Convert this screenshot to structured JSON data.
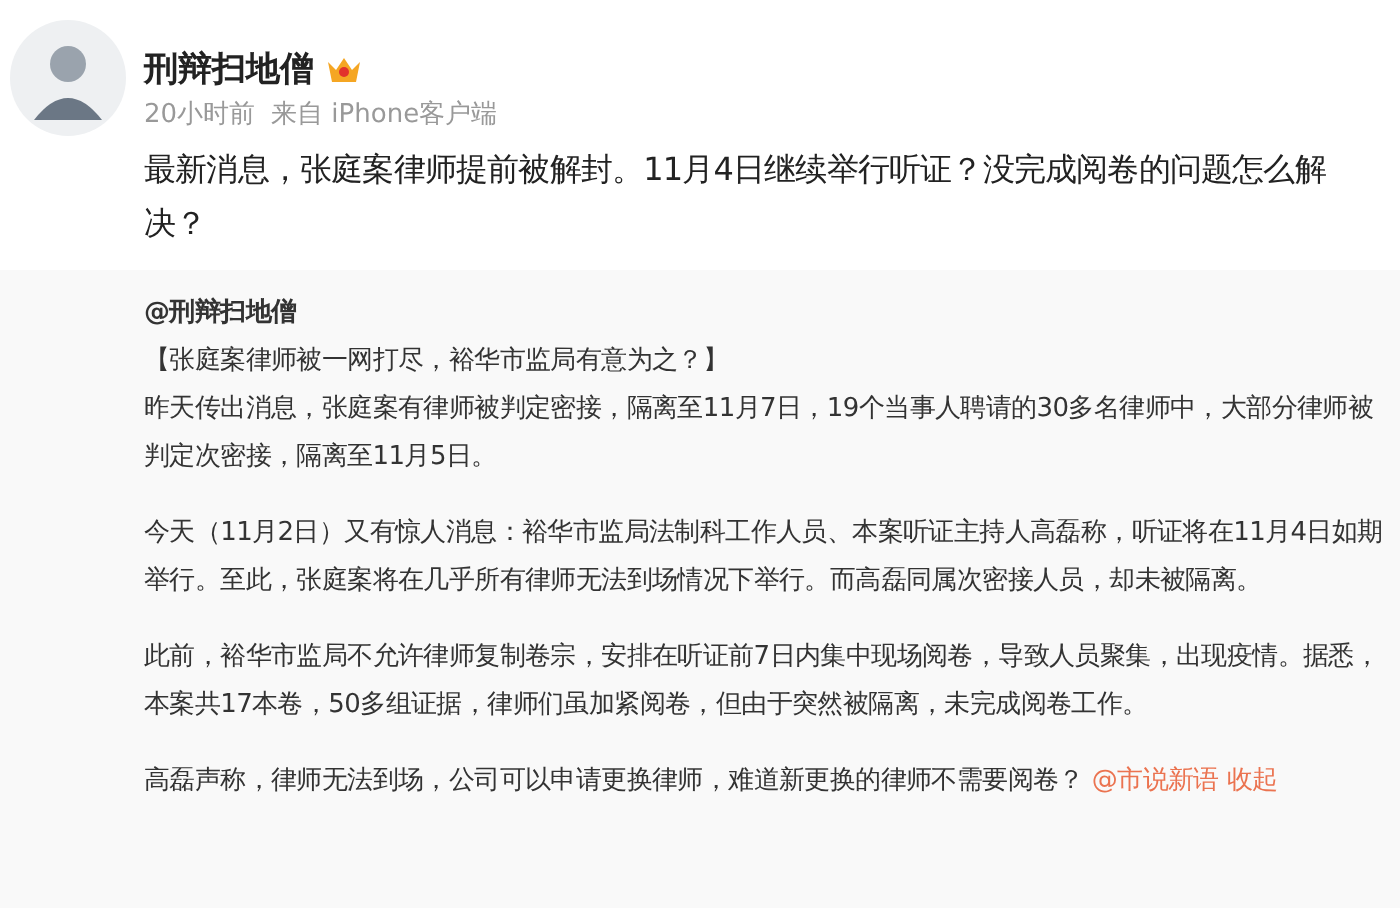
{
  "post": {
    "author": "刑辩扫地僧",
    "verified": true,
    "time": "20小时前",
    "source": "来自 iPhone客户端",
    "text": "最新消息，张庭案律师提前被解封。11月4日继续举行听证？没完成阅卷的问题怎么解决？"
  },
  "repost": {
    "mention": "@刑辩扫地僧",
    "headline": "【张庭案律师被一网打尽，裕华市监局有意为之？】",
    "paragraphs": [
      {
        "lines": [
          "昨天传出消息，张庭案有律师被判定密接，隔离至11月7日，19个当事人聘请的30多名律师中，大部分律师被判定次密接，隔离至11月5日。"
        ]
      },
      {
        "lines": [
          "今天（11月2日）又有惊人消息：裕华市监局法制科工作人员、本案听证主持人高磊称，听证将在11月4日如期举行。至此，张庭案将在几乎所有律师无法到场情况下举行。而高磊同属次密接人员，却未被隔离。"
        ]
      },
      {
        "lines": [
          "此前，裕华市监局不允许律师复制卷宗，安排在听证前7日内集中现场阅卷，导致人员聚集，出现疫情。据悉，本案共17本卷，50多组证据，律师们虽加紧阅卷，但由于突然被隔离，未完成阅卷工作。"
        ]
      },
      {
        "lines": [
          "高磊声称，律师无法到场，公司可以申请更换律师，难道新更换的律师不需要阅卷？"
        ],
        "links": [
          "@市说新语",
          "收起"
        ]
      }
    ]
  }
}
